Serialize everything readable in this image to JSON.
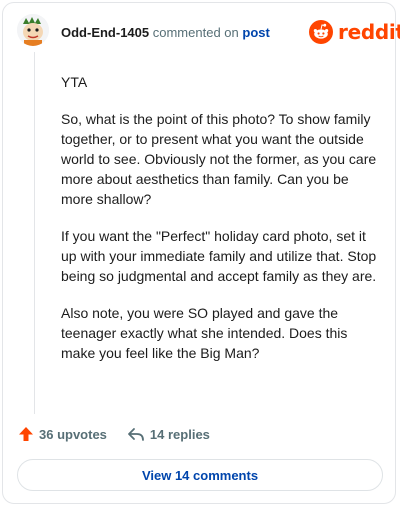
{
  "header": {
    "username": "Odd-End-1405",
    "verb": "commented on",
    "post_link": "post",
    "brand": "reddit"
  },
  "comment": {
    "paragraphs": [
      "YTA",
      "So, what is the point of this photo? To show family together, or to present what you want the outside world to see. Obviously not the former, as you care more about aesthetics than family. Can you be more shallow?",
      "If you want the \"Perfect\" holiday card photo, set it up with your immediate family and utilize that. Stop being so judgmental and accept family as they are.",
      "Also note, you were SO played and gave the teenager exactly what she intended. Does this make you feel like the Big Man?"
    ]
  },
  "actions": {
    "upvotes": "36 upvotes",
    "replies": "14 replies"
  },
  "footer": {
    "view_comments": "View 14 comments"
  },
  "colors": {
    "brand": "#ff4500",
    "link": "#0045ac",
    "muted": "#576f76"
  },
  "icons": {
    "avatar": "avatar",
    "brand": "reddit-snoo-icon",
    "upvote": "upvote-arrow-icon",
    "reply": "reply-icon"
  }
}
